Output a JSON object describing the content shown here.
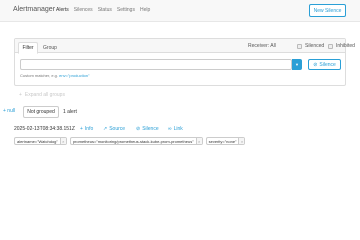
{
  "navbar": {
    "brand": "Alertmanager",
    "items": [
      "Alerts",
      "Silences",
      "Status",
      "Settings",
      "Help"
    ],
    "active": "Alerts",
    "new_silence": "New Silence"
  },
  "filter_panel": {
    "tabs": [
      "Filter",
      "Group"
    ],
    "receiver": "Receiver: All",
    "silenced": "Silenced",
    "inhibited": "Inhibited",
    "input_value": "",
    "silence_button": "Silence",
    "hint_prefix": "Custom matcher, e.g.",
    "hint_example": "env=\"production\""
  },
  "groups": {
    "expand": "Expand all groups",
    "plus": "+ null",
    "not_grouped": "Not grouped",
    "count": "1 alert"
  },
  "alert": {
    "timestamp": "2025-02-13T08:34:38.151Z",
    "actions": {
      "info": "Info",
      "source": "Source",
      "silence": "Silence",
      "link": "Link"
    },
    "labels": [
      "alertname=\"Watchdog\"",
      "prometheus=\"monitoring/prometheus-stack-kube-prom-prometheus\"",
      "severity=\"none\""
    ]
  },
  "colors": {
    "accent": "#2a9fd6",
    "navbar_bg": "#f8f8f8"
  }
}
